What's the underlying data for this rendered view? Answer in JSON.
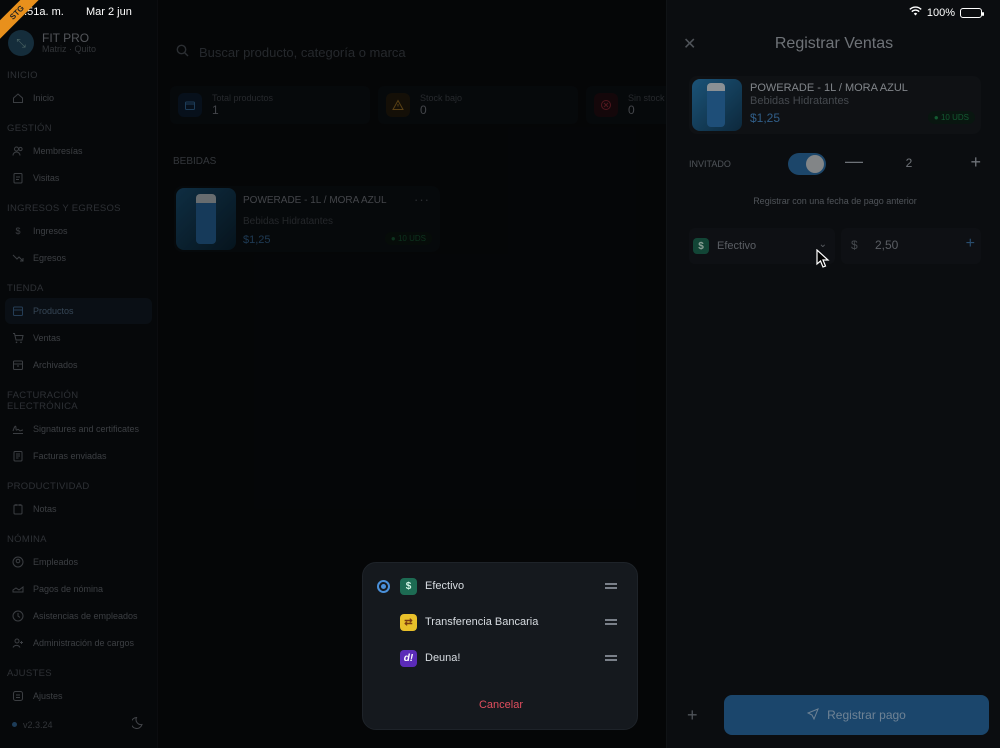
{
  "status_bar": {
    "time": "8:51a. m.",
    "date": "Mar 2 jun",
    "battery": "100%",
    "env_badge": "STG"
  },
  "brand": {
    "name": "FIT PRO",
    "subtitle": "Matriz · Quito"
  },
  "sidebar": {
    "sections": [
      {
        "title": "INICIO",
        "items": [
          {
            "label": "Inicio",
            "icon": "home-icon",
            "active": false
          }
        ]
      },
      {
        "title": "GESTIÓN",
        "items": [
          {
            "label": "Membresías",
            "icon": "users-icon",
            "active": false
          },
          {
            "label": "Visitas",
            "icon": "clipboard-icon",
            "active": false
          }
        ]
      },
      {
        "title": "INGRESOS Y EGRESOS",
        "items": [
          {
            "label": "Ingresos",
            "icon": "dollar-icon",
            "active": false
          },
          {
            "label": "Egresos",
            "icon": "trend-down-icon",
            "active": false
          }
        ]
      },
      {
        "title": "TIENDA",
        "items": [
          {
            "label": "Productos",
            "icon": "store-icon",
            "active": true
          },
          {
            "label": "Ventas",
            "icon": "cart-icon",
            "active": false
          },
          {
            "label": "Archivados",
            "icon": "archive-icon",
            "active": false
          }
        ]
      },
      {
        "title": "FACTURACIÓN ELECTRÓNICA",
        "items": [
          {
            "label": "Signatures and certificates",
            "icon": "signature-icon",
            "active": false
          },
          {
            "label": "Facturas enviadas",
            "icon": "invoice-icon",
            "active": false
          }
        ]
      },
      {
        "title": "PRODUCTIVIDAD",
        "items": [
          {
            "label": "Notas",
            "icon": "notes-icon",
            "active": false
          }
        ]
      },
      {
        "title": "NÓMINA",
        "items": [
          {
            "label": "Empleados",
            "icon": "user-circle-icon",
            "active": false
          },
          {
            "label": "Pagos de nómina",
            "icon": "payroll-icon",
            "active": false
          },
          {
            "label": "Asistencias de empleados",
            "icon": "clock-icon",
            "active": false
          },
          {
            "label": "Administración de cargos",
            "icon": "user-plus-icon",
            "active": false
          }
        ]
      },
      {
        "title": "AJUSTES",
        "items": [
          {
            "label": "Ajustes",
            "icon": "settings-icon",
            "active": false
          }
        ]
      }
    ],
    "version": "v2.3.24"
  },
  "main": {
    "search_placeholder": "Buscar producto, categoría o marca",
    "stats": [
      {
        "label": "Total productos",
        "value": "1",
        "icon": "box-icon",
        "color": "#3c7db6"
      },
      {
        "label": "Stock bajo",
        "value": "0",
        "icon": "warning-icon",
        "color": "#d59a2a"
      },
      {
        "label": "Sin stock",
        "value": "0",
        "icon": "x-circle-icon",
        "color": "#c0394a"
      }
    ],
    "category_title": "BEBIDAS",
    "products": [
      {
        "name": "POWERADE - 1L / MORA AZUL",
        "category": "Bebidas Hidratantes",
        "price": "$1,25",
        "stock": "10 UDS"
      }
    ]
  },
  "panel": {
    "title": "Registrar Ventas",
    "product": {
      "name": "POWERADE - 1L / MORA AZUL",
      "category": "Bebidas Hidratantes",
      "price": "$1,25",
      "stock": "10 UDS"
    },
    "guest_label": "INVITADO",
    "guest_enabled": true,
    "quantity": "2",
    "past_date_label": "Registrar con una fecha de pago anterior",
    "payment_method": "Efectivo",
    "currency_symbol": "$",
    "amount": "2,50",
    "register_button": "Registrar pago"
  },
  "payment_popup": {
    "options": [
      {
        "label": "Efectivo",
        "icon": "dollar-icon",
        "selected": true,
        "color": "#1d6b53"
      },
      {
        "label": "Transferencia Bancaria",
        "icon": "bank-transfer-icon",
        "selected": false,
        "color": "#e8c02a"
      },
      {
        "label": "Deuna!",
        "icon": "deuna-icon",
        "selected": false,
        "color": "#5b2bb8"
      }
    ],
    "cancel_label": "Cancelar"
  },
  "colors": {
    "accent": "#2a6ca6",
    "danger": "#e04e5e",
    "success": "#1e8a4c"
  }
}
